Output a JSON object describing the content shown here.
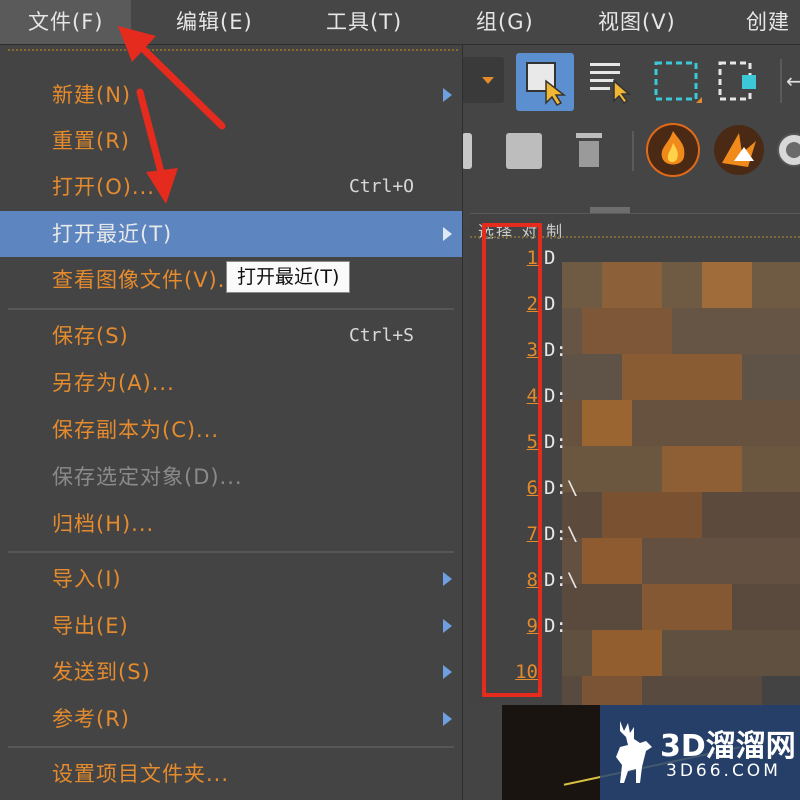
{
  "menubar": {
    "items": [
      "文件(F)",
      "编辑(E)",
      "工具(T)",
      "组(G)",
      "视图(V)",
      "创建"
    ]
  },
  "file_menu": {
    "new": {
      "label": "新建(N)"
    },
    "reset": {
      "label": "重置(R)"
    },
    "open": {
      "label": "打开(O)...",
      "shortcut": "Ctrl+O"
    },
    "open_recent": {
      "label": "打开最近(T)"
    },
    "view_image": {
      "label": "查看图像文件(V)..."
    },
    "save": {
      "label": "保存(S)",
      "shortcut": "Ctrl+S"
    },
    "save_as": {
      "label": "另存为(A)..."
    },
    "save_copy": {
      "label": "保存副本为(C)..."
    },
    "save_selected": {
      "label": "保存选定对象(D)..."
    },
    "archive": {
      "label": "归档(H)..."
    },
    "import": {
      "label": "导入(I)"
    },
    "export": {
      "label": "导出(E)"
    },
    "send_to": {
      "label": "发送到(S)"
    },
    "reference": {
      "label": "参考(R)"
    },
    "set_project": {
      "label": "设置项目文件夹..."
    }
  },
  "tooltip": {
    "text": "打开最近(T)"
  },
  "right_panel": {
    "header": "选择    对    制"
  },
  "recent_files": [
    {
      "num": "1",
      "path": "D"
    },
    {
      "num": "2",
      "path": "D"
    },
    {
      "num": "3",
      "path": "D:"
    },
    {
      "num": "4",
      "path": "D:"
    },
    {
      "num": "5",
      "path": "D:"
    },
    {
      "num": "6",
      "path": "D:\\"
    },
    {
      "num": "7",
      "path": "D:\\"
    },
    {
      "num": "8",
      "path": "D:\\"
    },
    {
      "num": "9",
      "path": "D:"
    },
    {
      "num": "10",
      "path": ""
    }
  ],
  "watermark": {
    "title": "3D溜溜网",
    "subtitle": "3D66.COM"
  },
  "colors": {
    "accent_orange": "#e58b2d",
    "selection_blue": "#5d86c1",
    "annotation_red": "#e52a1e"
  }
}
